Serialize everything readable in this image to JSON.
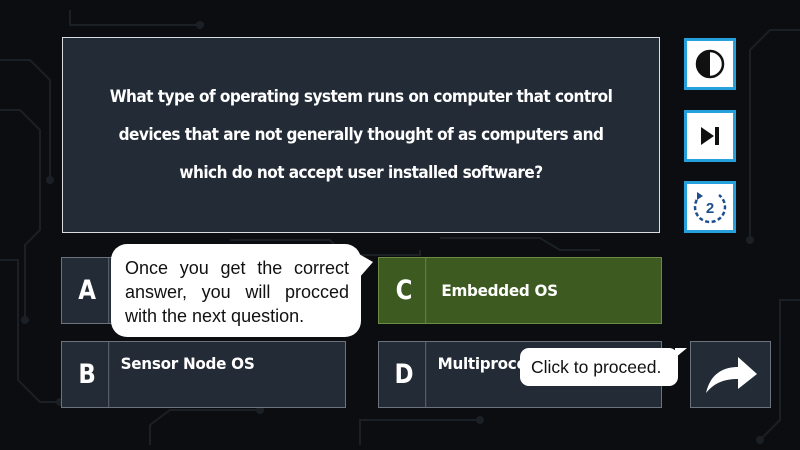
{
  "question": {
    "text": "What type of operating system runs on computer that control devices that are not generally thought of as computers and which do not accept user installed software?"
  },
  "side_controls": [
    {
      "name": "contrast",
      "icon": "contrast-icon"
    },
    {
      "name": "skip",
      "icon": "skip-next-icon"
    },
    {
      "name": "retry",
      "icon": "retry-counter-icon",
      "count": "2"
    }
  ],
  "options": [
    {
      "letter": "A",
      "text": "",
      "state": "default"
    },
    {
      "letter": "B",
      "text": "Sensor Node OS",
      "state": "default"
    },
    {
      "letter": "C",
      "text": "Embedded OS",
      "state": "correct"
    },
    {
      "letter": "D",
      "text": "Multiproce",
      "state": "default"
    }
  ],
  "tooltips": {
    "correct_hint": "Once you get the correct answer, you will procced with the next question.",
    "proceed_hint": "Click to proceed."
  },
  "next_button": {
    "icon": "forward-arrow-icon"
  },
  "colors": {
    "background": "#0b0d10",
    "panel": "#232b36",
    "correct": "#3d5a21",
    "accent": "#25a0dc",
    "text": "#ffffff"
  }
}
